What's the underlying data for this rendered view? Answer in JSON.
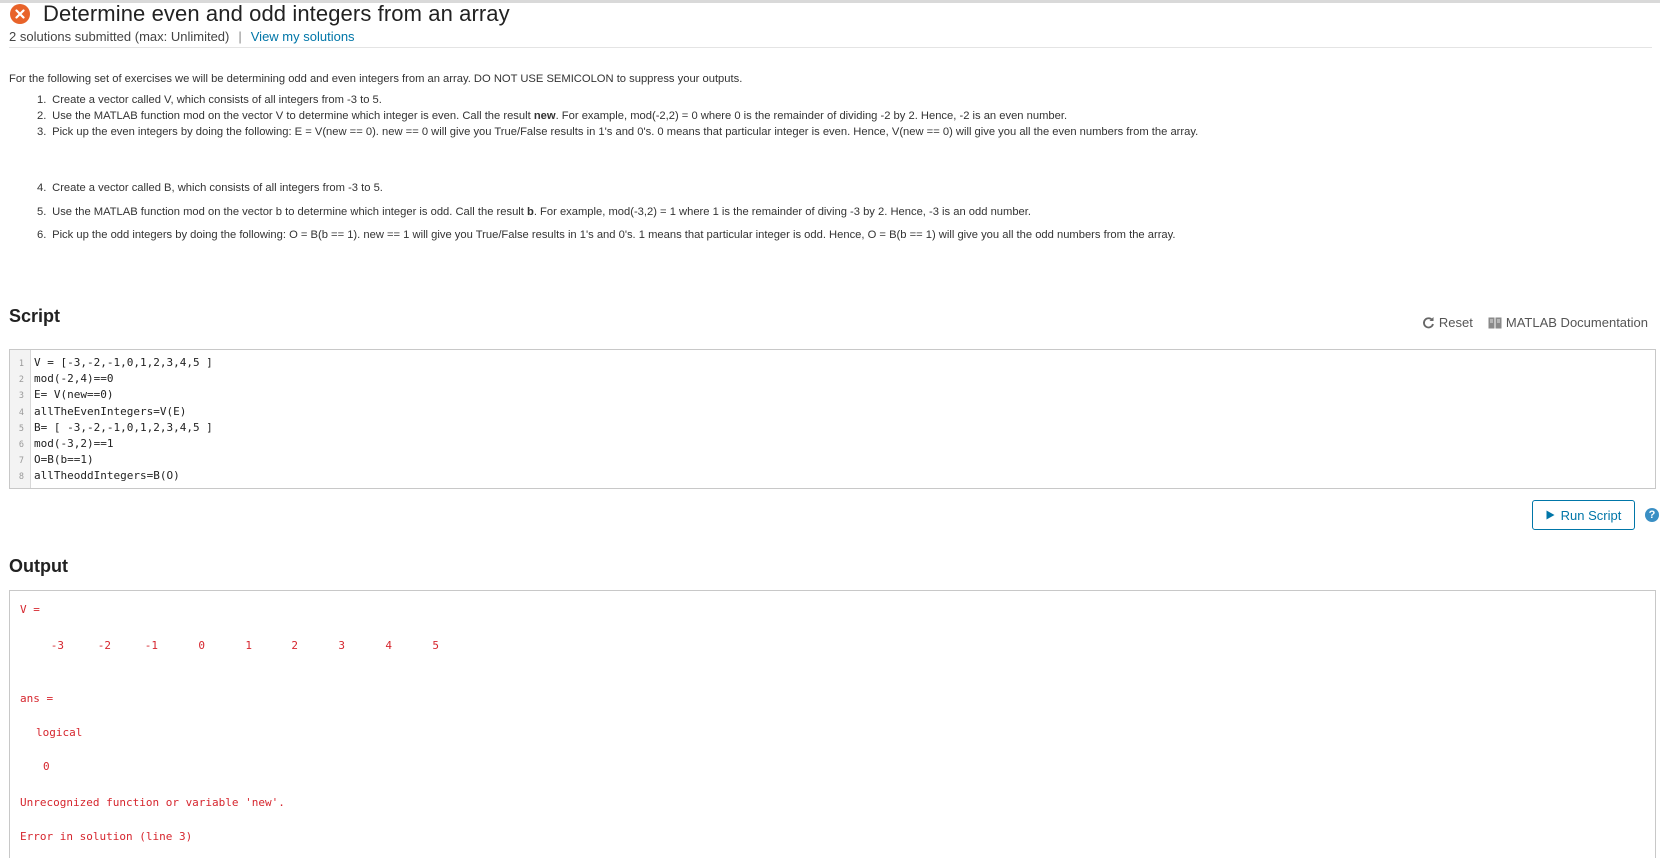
{
  "header": {
    "title": "Determine even and odd integers from an array",
    "solutions": "2 solutions submitted (max: Unlimited)",
    "separator": "|",
    "view_link": "View my solutions"
  },
  "description": {
    "intro": "For the following set of exercises we will be determining odd and even integers from an array. DO NOT USE SEMICOLON to suppress your outputs.",
    "steps": [
      {
        "num": "1.",
        "pre": "Create a vector called V, which consists of all integers from -3 to 5.",
        "bold": "",
        "post": ""
      },
      {
        "num": "2.",
        "pre": "Use the MATLAB function mod on the vector V to determine which integer is even. Call the result ",
        "bold": "new",
        "post": ". For example, mod(-2,2) = 0 where 0 is the remainder of dividing -2 by 2. Hence, -2 is an even number."
      },
      {
        "num": "3.",
        "pre": "Pick up the even integers by doing the following: E = V(new == 0). new == 0 will give you True/False results in 1's and 0's. 0 means that particular integer is even. Hence, V(new == 0) will give you all the even numbers from the array.",
        "bold": "",
        "post": ""
      },
      {
        "num": "4.",
        "pre": "Create a vector called B, which consists of all integers from -3 to 5.",
        "bold": "",
        "post": ""
      },
      {
        "num": "5.",
        "pre": "Use the MATLAB function mod on the vector b to determine which integer is odd. Call the result ",
        "bold": "b",
        "post": ". For example, mod(-3,2) = 1 where 1 is the remainder of diving -3 by 2. Hence, -3 is an odd number."
      },
      {
        "num": "6.",
        "pre": "Pick up the odd integers by doing the following: O = B(b == 1). new == 1 will give you True/False results in 1's and 0's. 1 means that particular integer is odd. Hence, O = B(b == 1) will give you all the odd numbers from the array.",
        "bold": "",
        "post": ""
      }
    ]
  },
  "script": {
    "title": "Script",
    "reset_label": "Reset",
    "docs_label": "MATLAB Documentation",
    "lines": [
      {
        "n": "1",
        "code": "V = [-3,-2,-1,0,1,2,3,4,5 ]"
      },
      {
        "n": "2",
        "code": "mod(-2,4)==0"
      },
      {
        "n": "3",
        "code": "E= V(new==0)"
      },
      {
        "n": "4",
        "code": "allTheEvenIntegers=V(E)"
      },
      {
        "n": "5",
        "code": "B= [ -3,-2,-1,0,1,2,3,4,5 ]"
      },
      {
        "n": "6",
        "code": "mod(-3,2)==1"
      },
      {
        "n": "7",
        "code": "O=B(b==1)"
      },
      {
        "n": "8",
        "code": "allTheoddIntegers=B(O)"
      }
    ],
    "run_label": "Run Script",
    "help_label": "?"
  },
  "output": {
    "title": "Output",
    "var1": "V =",
    "values": [
      "-3",
      "-2",
      "-1",
      "0",
      "1",
      "2",
      "3",
      "4",
      "5"
    ],
    "var2": "ans =",
    "type": "logical",
    "result": "0",
    "error": "Unrecognized function or variable 'new'.",
    "error_loc": "Error in solution (line 3)"
  },
  "colors": {
    "accent": "#0076a8",
    "fail": "#e8632a",
    "error_text": "#d6262e"
  }
}
